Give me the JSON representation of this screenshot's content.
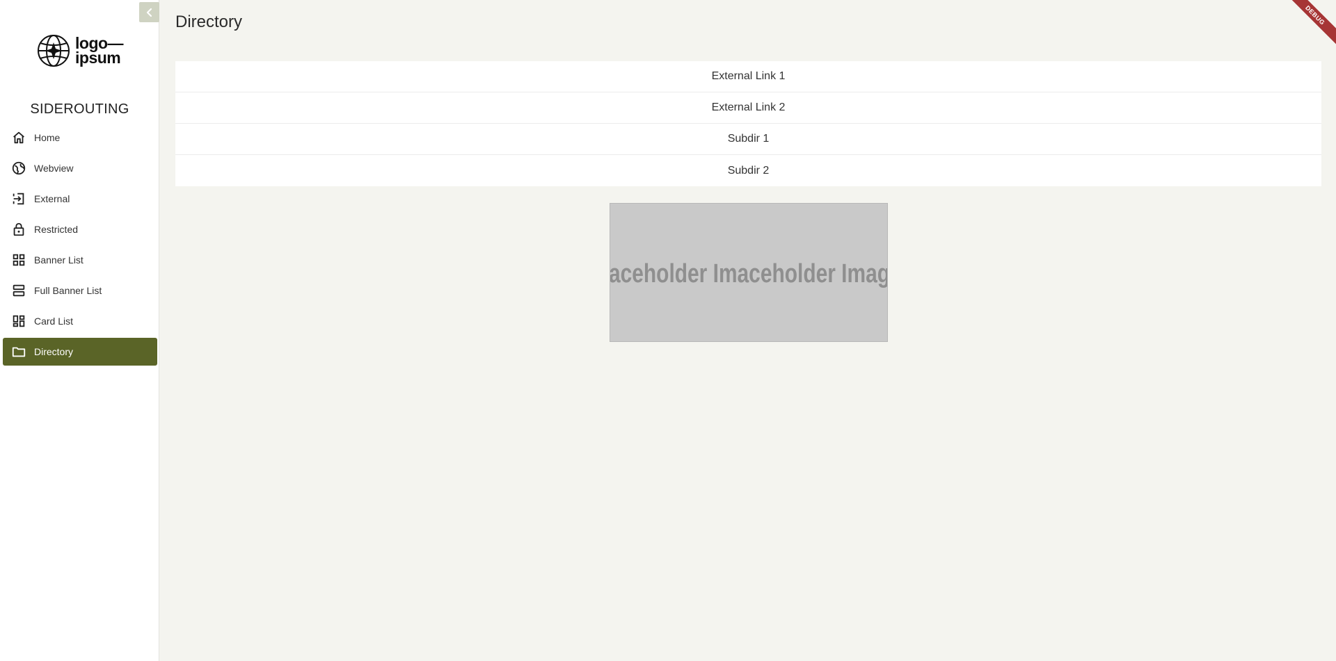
{
  "logo": {
    "line1": "logo—",
    "line2": "ipsum"
  },
  "app_title": "SIDEROUTING",
  "sidebar": {
    "items": [
      {
        "label": "Home",
        "icon": "home-icon"
      },
      {
        "label": "Webview",
        "icon": "globe-icon"
      },
      {
        "label": "External",
        "icon": "login-icon"
      },
      {
        "label": "Restricted",
        "icon": "lock-icon"
      },
      {
        "label": "Banner List",
        "icon": "grid-icon"
      },
      {
        "label": "Full Banner List",
        "icon": "rows-icon"
      },
      {
        "label": "Card List",
        "icon": "dashboard-icon"
      },
      {
        "label": "Directory",
        "icon": "folder-icon",
        "active": true
      }
    ]
  },
  "page": {
    "title": "Directory"
  },
  "directory": {
    "items": [
      "External Link 1",
      "External Link 2",
      "Subdir 1",
      "Subdir 2"
    ]
  },
  "placeholder": {
    "text": "aceholder Imaceholder Imag"
  },
  "debug_banner": "DEBUG",
  "colors": {
    "accent": "#5a6427",
    "background": "#f4f4ef",
    "ribbon": "#a63535"
  }
}
